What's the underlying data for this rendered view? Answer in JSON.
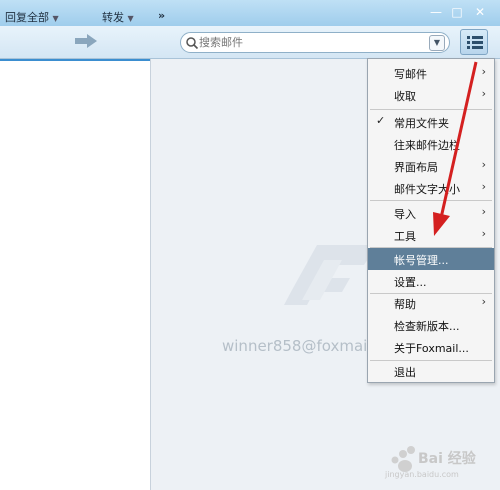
{
  "window": {
    "min_glyph": "—",
    "max_glyph": "□",
    "close_glyph": "✕"
  },
  "toolbar": {
    "reply_all_label": "回复全部",
    "forward_label": "转发",
    "more_label": "»",
    "search_placeholder": "搜索邮件",
    "menu_icon": "hamburger-list-icon"
  },
  "main": {
    "account_email": "winner858@foxmail.com"
  },
  "menu": {
    "items": [
      {
        "label": "写邮件",
        "submenu": true
      },
      {
        "label": "收取",
        "submenu": true
      },
      {
        "label": "常用文件夹",
        "checked": true
      },
      {
        "label": "往来邮件边栏"
      },
      {
        "label": "界面布局",
        "submenu": true
      },
      {
        "label": "邮件文字大小",
        "submenu": true
      },
      {
        "label": "导入",
        "submenu": true
      },
      {
        "label": "工具",
        "submenu": true
      },
      {
        "label": "帐号管理...",
        "highlighted": true
      },
      {
        "label": "设置..."
      },
      {
        "label": "帮助",
        "submenu": true
      },
      {
        "label": "检查新版本..."
      },
      {
        "label": "关于Foxmail..."
      },
      {
        "label": "退出"
      }
    ]
  },
  "watermark": {
    "text": "Bai 经验",
    "url": "jingyan.baidu.com"
  },
  "colors": {
    "highlight": "#5f7f99",
    "annotation_arrow": "#d42020"
  }
}
